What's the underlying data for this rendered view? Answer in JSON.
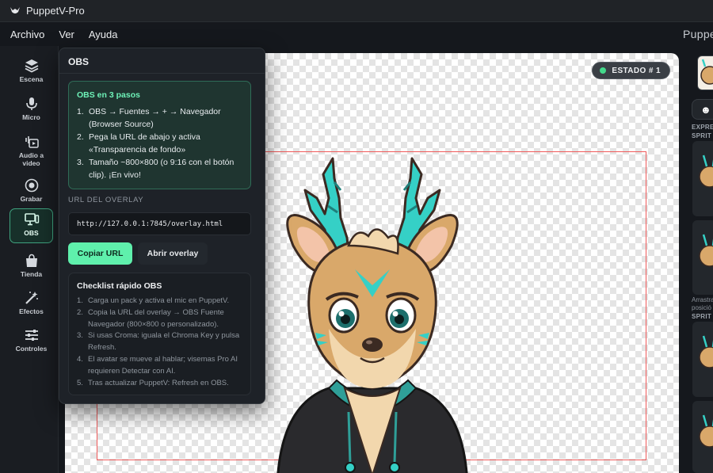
{
  "window": {
    "title": "PuppetV-Pro"
  },
  "menu": {
    "items": [
      "Archivo",
      "Ver",
      "Ayuda"
    ],
    "brand": "Puppe"
  },
  "nav": {
    "items": [
      {
        "label": "Escena",
        "icon": "layers-icon"
      },
      {
        "label": "Micro",
        "icon": "microphone-icon"
      },
      {
        "label": "Audio a video",
        "icon": "audio-video-icon"
      },
      {
        "label": "Grabar",
        "icon": "record-icon"
      },
      {
        "label": "OBS",
        "icon": "monitor-icon",
        "active": true
      },
      {
        "label": "Tienda",
        "icon": "shopping-bag-icon"
      },
      {
        "label": "Efectos",
        "icon": "magic-wand-icon"
      },
      {
        "label": "Controles",
        "icon": "sliders-icon"
      }
    ]
  },
  "stage": {
    "state_badge": "ESTADO # 1",
    "state_color": "#43d98b"
  },
  "obs": {
    "title": "OBS",
    "steps_title": "OBS en 3 pasos",
    "steps": [
      {
        "num": "1.",
        "text": "OBS → Fuentes → + → Navegador (Browser Source)"
      },
      {
        "num": "2.",
        "text": "Pega la URL de abajo y activa «Transparencia de fondo»"
      },
      {
        "num": "3.",
        "text": "Tamaño ~800×800 (o 9:16 con el botón clip). ¡En vivo!"
      }
    ],
    "url_label": "URL DEL OVERLAY",
    "url": "http://127.0.0.1:7845/overlay.html",
    "copy_button": "Copiar URL",
    "open_button": "Abrir overlay",
    "checklist_title": "Checklist rápido OBS",
    "checklist": [
      {
        "num": "1.",
        "text": "Carga un pack y activa el mic en PuppetV."
      },
      {
        "num": "2.",
        "text": "Copia la URL del overlay → OBS Fuente Navegador (800×800 o personalizado)."
      },
      {
        "num": "3.",
        "text": "Si usas Croma: iguala el Chroma Key y pulsa Refresh."
      },
      {
        "num": "4.",
        "text": "El avatar se mueve al hablar; visemas Pro AI requieren Detectar con AI."
      },
      {
        "num": "5.",
        "text": "Tras actualizar PuppetV: Refresh en OBS."
      }
    ]
  },
  "right_panel": {
    "label_expr_1": "EXPRE",
    "label_sprite_1": "SPRIT",
    "drag_line_1": "Arrastra",
    "drag_line_2": "posició",
    "label_sprite_2": "SPRIT",
    "chip_icon": "smiley-icon"
  },
  "colors": {
    "accent": "#5ff0ac",
    "accent_dark": "#1f3530",
    "frame": "#ef5a5a",
    "bg": "#15181d"
  }
}
